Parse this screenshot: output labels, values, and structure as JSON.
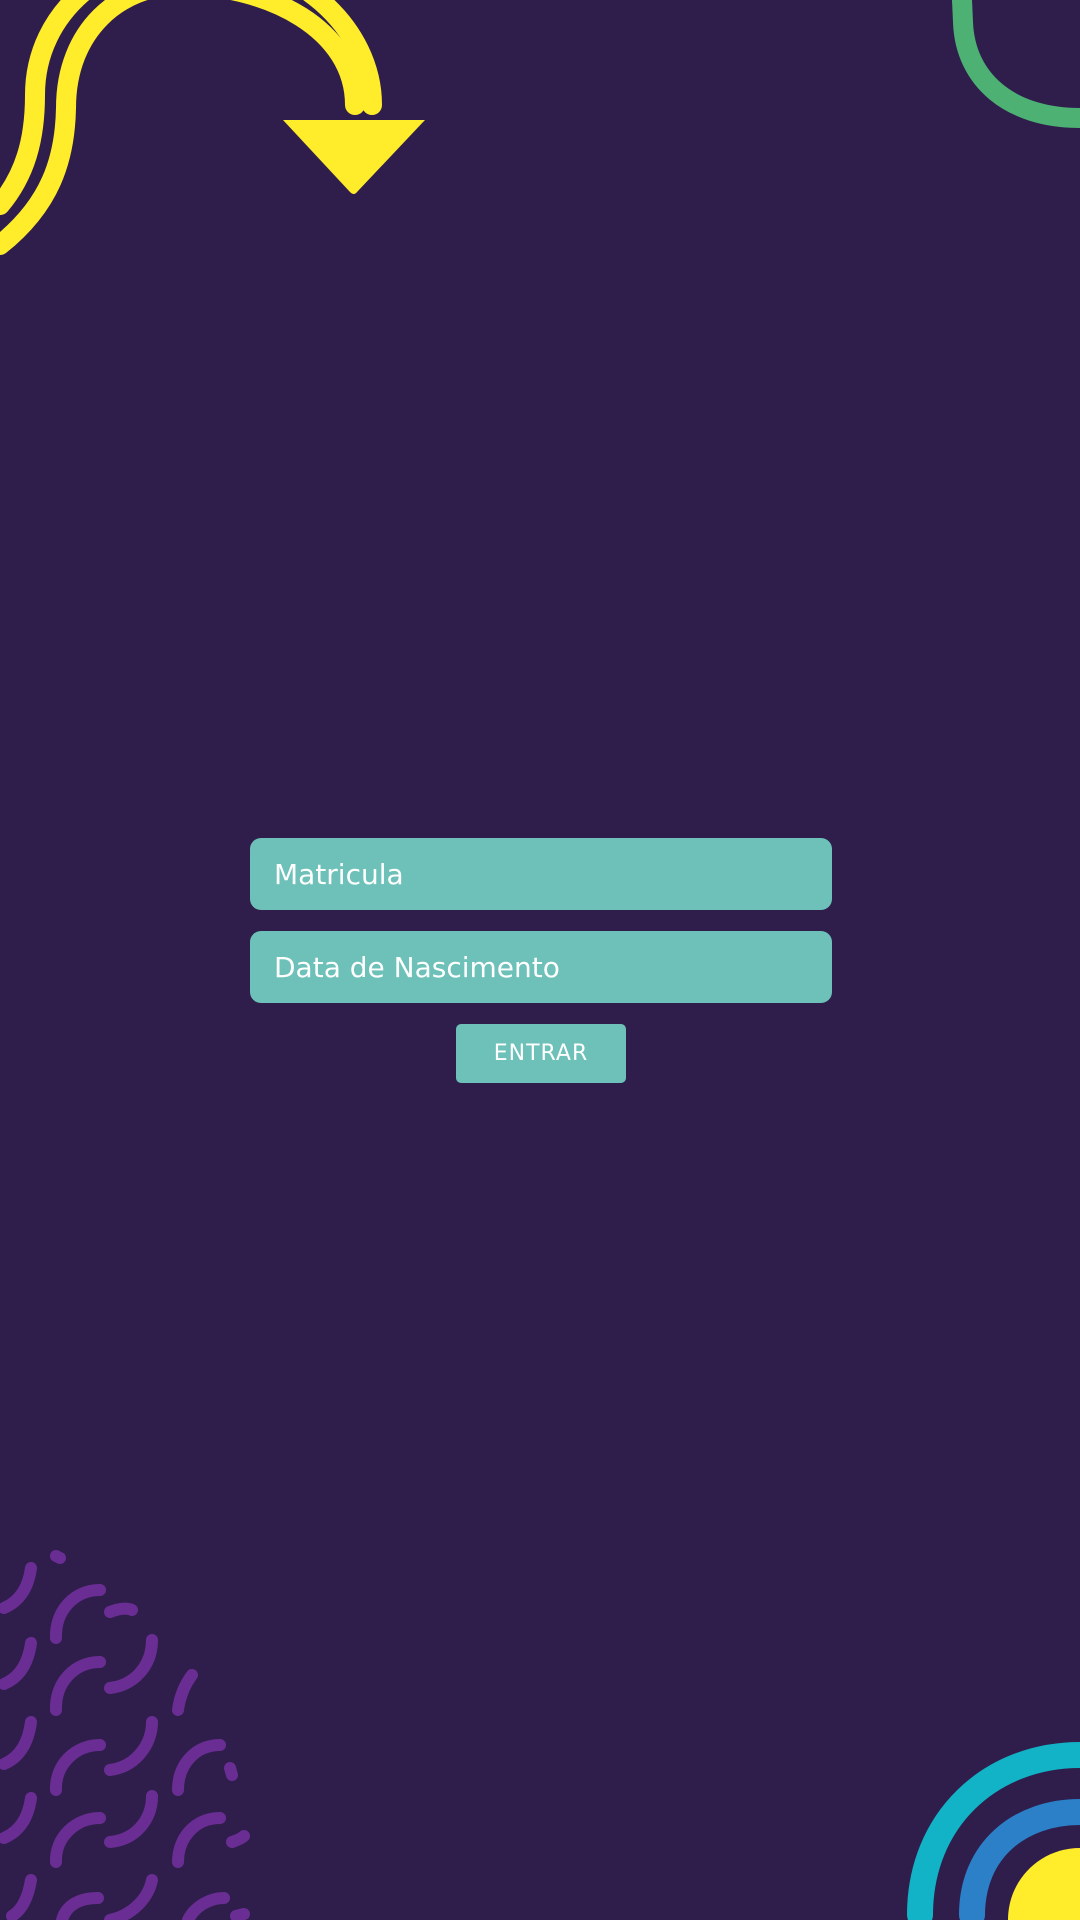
{
  "login": {
    "matricula_placeholder": "Matricula",
    "nascimento_placeholder": "Data de Nascimento",
    "submit_label": "ENTRAR"
  },
  "colors": {
    "background": "#2f1e4c",
    "field": "#6dc1b9",
    "text": "#ffffff",
    "yellow": "#ffec2b",
    "green": "#4db173",
    "purple": "#6a2d94",
    "cyan": "#12b3c6",
    "blue": "#2b80c8"
  }
}
